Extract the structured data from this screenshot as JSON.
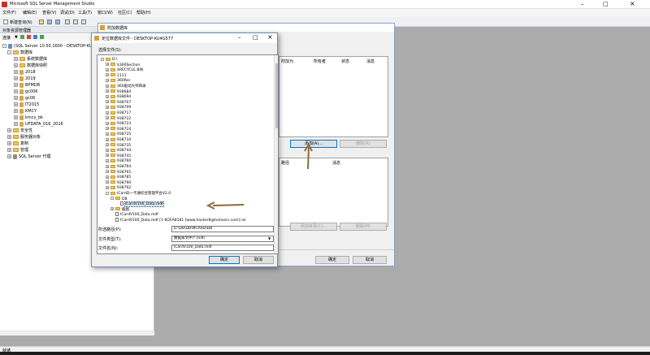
{
  "app": {
    "title": "Microsoft SQL Server Management Studio"
  },
  "menu": [
    "文件(F)",
    "编辑(E)",
    "查看(V)",
    "调试(D)",
    "工具(T)",
    "窗口(W)",
    "社区(C)",
    "帮助(H)"
  ],
  "toolbar": {
    "new_query": "新建查询(N)"
  },
  "object_explorer": {
    "title": "对象资源管理器",
    "connect_label": "连接",
    "server": "(SQL Server 10.50.1600 - DESKTOP-KU",
    "databases_label": "数据库",
    "items": [
      "系统数据库",
      "数据库快照",
      "2018",
      "2019",
      "BPMDB",
      "gc006",
      "gc06",
      "IT2015",
      "KMCY",
      "kmcy_bk",
      "UFDATA_016_2016"
    ],
    "top_nodes": [
      "安全性",
      "服务器对象",
      "复制",
      "管理"
    ],
    "agent": "SQL Server 代理"
  },
  "attach_dialog": {
    "title": "附加数据库",
    "columns_top": [
      "附加为",
      "所有者",
      "状态",
      "消息"
    ],
    "add_button": "添加(A)...",
    "remove_button": "删除(R)",
    "details_col": "路径",
    "details_msg": "消息",
    "add_catalog": "添加目录(C)...",
    "remove2": "删除(M)",
    "ok": "确定",
    "cancel": "取消"
  },
  "file_dialog": {
    "title": "定位数据库文件 - DESKTOP-KU4G577",
    "select_label": "选择文件(S):",
    "tree": [
      {
        "t": "D:\\",
        "lvl": 0,
        "kind": "open"
      },
      {
        "t": "$360Section",
        "lvl": 1,
        "kind": "folder"
      },
      {
        "t": "$RECYCLE.BIN",
        "lvl": 1,
        "kind": "folder"
      },
      {
        "t": "1111",
        "lvl": 1,
        "kind": "folder"
      },
      {
        "t": "360Rec",
        "lvl": 1,
        "kind": "folder"
      },
      {
        "t": "360驱动大师目录",
        "lvl": 1,
        "kind": "folder"
      },
      {
        "t": "938684",
        "lvl": 1,
        "kind": "folder"
      },
      {
        "t": "938694",
        "lvl": 1,
        "kind": "folder"
      },
      {
        "t": "938707",
        "lvl": 1,
        "kind": "folder"
      },
      {
        "t": "938709",
        "lvl": 1,
        "kind": "folder"
      },
      {
        "t": "938717",
        "lvl": 1,
        "kind": "folder"
      },
      {
        "t": "938722",
        "lvl": 1,
        "kind": "folder"
      },
      {
        "t": "938723",
        "lvl": 1,
        "kind": "folder"
      },
      {
        "t": "938724",
        "lvl": 1,
        "kind": "folder"
      },
      {
        "t": "938725",
        "lvl": 1,
        "kind": "folder"
      },
      {
        "t": "938734",
        "lvl": 1,
        "kind": "folder"
      },
      {
        "t": "938735",
        "lvl": 1,
        "kind": "folder"
      },
      {
        "t": "938744",
        "lvl": 1,
        "kind": "folder"
      },
      {
        "t": "938745",
        "lvl": 1,
        "kind": "folder"
      },
      {
        "t": "938760",
        "lvl": 1,
        "kind": "folder"
      },
      {
        "t": "938764",
        "lvl": 1,
        "kind": "folder"
      },
      {
        "t": "938765",
        "lvl": 1,
        "kind": "folder"
      },
      {
        "t": "938785",
        "lvl": 1,
        "kind": "folder"
      },
      {
        "t": "938790",
        "lvl": 1,
        "kind": "folder"
      },
      {
        "t": "938792",
        "lvl": 1,
        "kind": "folder"
      },
      {
        "t": "ICardD一卡通综合管理平台V2.0",
        "lvl": 1,
        "kind": "open"
      },
      {
        "t": "DB",
        "lvl": 2,
        "kind": "open"
      },
      {
        "t": "ICardV100_Data.mdf",
        "lvl": 3,
        "kind": "file",
        "sel": true
      },
      {
        "t": "截图",
        "lvl": 2,
        "kind": "folder"
      },
      {
        "t": "ICardV100_Data.mdf",
        "lvl": 2,
        "kind": "file"
      },
      {
        "t": "ICardV100_Data.mdf [1-6OEA8181 [www.hacker8@tumasin.com].rar",
        "lvl": 2,
        "kind": "file"
      }
    ],
    "path_label": "所选路径(P):",
    "path_value": "D:\\DB\\DB\\MCARD\\DB",
    "type_label": "文件类型(T):",
    "type_value": "数据库文件(*.mdf)",
    "name_label": "文件名(N):",
    "name_value": "ICardV100_Data.mdf",
    "ok": "确定",
    "cancel": "取消"
  },
  "status": {
    "text": "就绪"
  }
}
